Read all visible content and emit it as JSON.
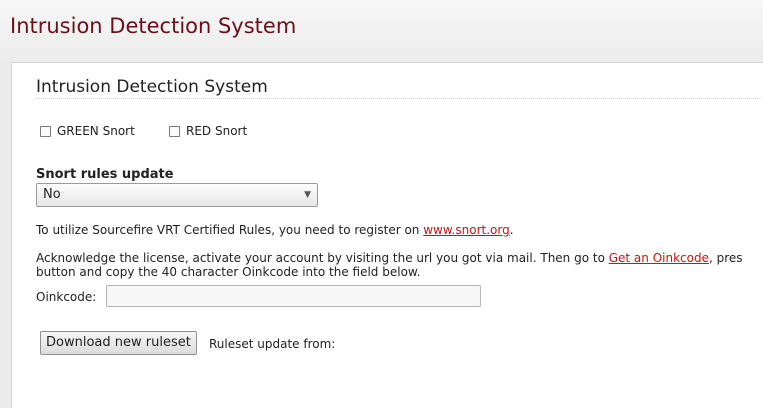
{
  "header": {
    "title": "Intrusion Detection System"
  },
  "section": {
    "title": "Intrusion Detection System"
  },
  "checkboxes": [
    {
      "label": "GREEN Snort",
      "checked": false
    },
    {
      "label": "RED Snort",
      "checked": false
    }
  ],
  "rules_update": {
    "label": "Snort rules update",
    "selected": "No"
  },
  "info": {
    "register_text": "To utilize Sourcefire VRT Certified Rules, you need to register on ",
    "register_link": "www.snort.org",
    "register_end": ".",
    "ack_text_1": "Acknowledge the license, activate your account by visiting the url you got via mail. Then go to ",
    "ack_link": "Get an Oinkcode",
    "ack_text_2": ", pres",
    "ack_line2": "button and copy the 40 character Oinkcode into the field below."
  },
  "oinkcode": {
    "label": "Oinkcode:",
    "value": ""
  },
  "download": {
    "button_label": "Download new ruleset",
    "update_from_label": "Ruleset update from:"
  }
}
